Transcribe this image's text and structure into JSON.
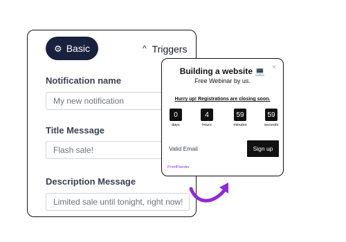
{
  "tabs": {
    "basic_label": "Basic",
    "triggers_label": "Triggers"
  },
  "form": {
    "notification_name_label": "Notification name",
    "notification_name_placeholder": "My new notification",
    "title_label": "Title Message",
    "title_value": "Flash sale!",
    "description_label": "Description Message",
    "description_value": "Limited sale until tonight, right now!"
  },
  "popup": {
    "title": "Building a website 💻",
    "subtitle": "Free Webinar by us.",
    "hurry": "Hurry up! Registrations are closing soon.",
    "timer": [
      {
        "value": "0",
        "unit": "days"
      },
      {
        "value": "4",
        "unit": "hours"
      },
      {
        "value": "59",
        "unit": "minutes"
      },
      {
        "value": "59",
        "unit": "seconds"
      }
    ],
    "email_placeholder": "Valid Email",
    "signup_label": "Sign up",
    "brand": "ProofFlander"
  },
  "colors": {
    "tab_active_bg": "#18213d",
    "arrow": "#8e2bd8",
    "brand": "#7c3aed"
  }
}
